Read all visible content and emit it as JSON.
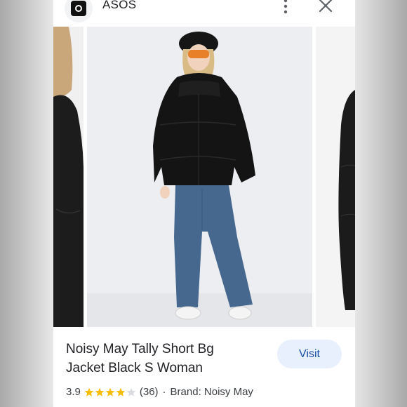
{
  "header": {
    "site_name": "ASOS",
    "icons": {
      "logo": "asos-logo-icon",
      "more": "more-vert-icon",
      "close": "close-icon"
    }
  },
  "product": {
    "title": "Noisy May Tally Short Bg Jacket Black S Woman",
    "rating": "3.9",
    "rating_value": 3.9,
    "stars_max": 5,
    "review_count": "(36)",
    "separator": "·",
    "brand_label": "Brand: Noisy May"
  },
  "actions": {
    "visit_label": "Visit"
  },
  "colors": {
    "visit_bg": "#e8f0fe",
    "visit_text": "#174ea6",
    "star_filled": "#fbbc04",
    "star_empty": "#dadce0"
  }
}
